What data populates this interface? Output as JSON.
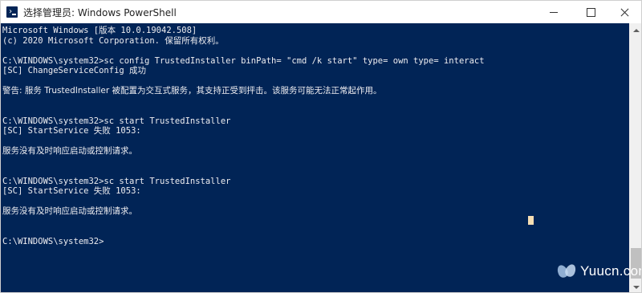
{
  "window": {
    "title": "选择管理员: Windows PowerShell"
  },
  "console": {
    "lines": [
      "Microsoft Windows [版本 10.0.19042.508]",
      "(c) 2020 Microsoft Corporation. 保留所有权利。",
      "",
      "C:\\WINDOWS\\system32>sc config TrustedInstaller binPath= \"cmd /k start\" type= own type= interact",
      "[SC] ChangeServiceConfig 成功",
      "",
      "警告: 服务 TrustedInstaller 被配置为交互式服务，其支持正受到抨击。该服务可能无法正常起作用。",
      "",
      "",
      "C:\\WINDOWS\\system32>sc start TrustedInstaller",
      "[SC] StartService 失败 1053:",
      "",
      "服务没有及时响应启动或控制请求。",
      "",
      "",
      "C:\\WINDOWS\\system32>sc start TrustedInstaller",
      "[SC] StartService 失败 1053:",
      "",
      "服务没有及时响应启动或控制请求。",
      "",
      "",
      "C:\\WINDOWS\\system32>"
    ]
  },
  "watermark": {
    "text": "Yuucn.com"
  },
  "colors": {
    "console_background": "#012456",
    "console_text": "#eeedf0",
    "cursor": "#f5deb3"
  },
  "icons": {
    "app": "powershell-icon",
    "minimize": "minimize-icon",
    "maximize": "maximize-icon",
    "close": "close-icon"
  }
}
